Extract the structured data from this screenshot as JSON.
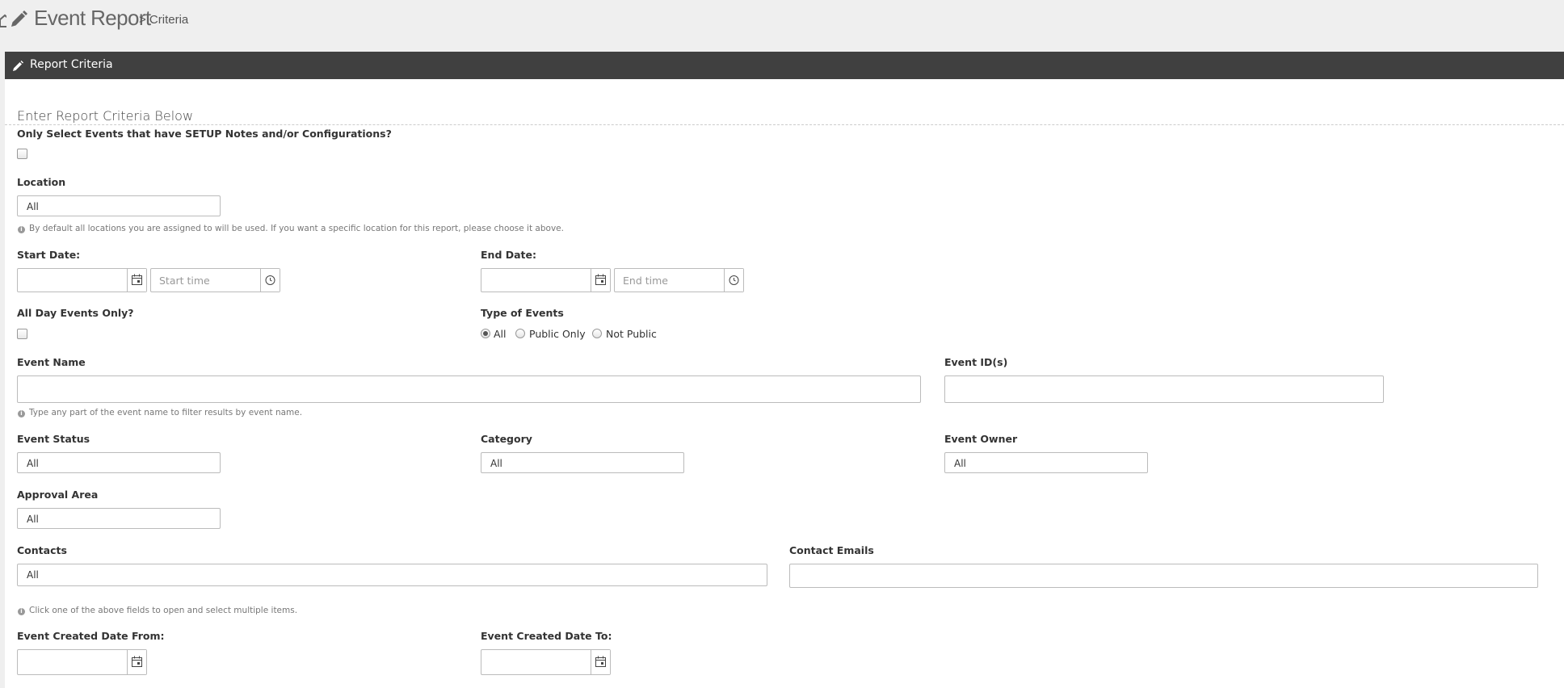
{
  "header": {
    "title": "Event Report",
    "crumb": "> Criteria"
  },
  "panel": {
    "title": "Report Criteria"
  },
  "form": {
    "intro": "Enter Report Criteria Below",
    "setup_only_label": "Only Select Events that have SETUP Notes and/or Configurations?",
    "location_label": "Location",
    "location_value": "All",
    "location_help": "By default all locations you are assigned to will be used. If you want a specific location for this report, please choose it above.",
    "start_date_label": "Start Date:",
    "start_time_placeholder": "Start time",
    "end_date_label": "End Date:",
    "end_time_placeholder": "End time",
    "all_day_label": "All Day Events Only?",
    "type_label": "Type of Events",
    "type_options": [
      "All",
      "Public Only",
      "Not Public"
    ],
    "event_name_label": "Event Name",
    "event_name_help": "Type any part of the event name to filter results by event name.",
    "event_ids_label": "Event ID(s)",
    "event_status_label": "Event Status",
    "event_status_value": "All",
    "category_label": "Category",
    "category_value": "All",
    "event_owner_label": "Event Owner",
    "event_owner_value": "All",
    "approval_area_label": "Approval Area",
    "approval_area_value": "All",
    "contacts_label": "Contacts",
    "contacts_value": "All",
    "contact_emails_label": "Contact Emails",
    "multi_help": "Click one of the above fields to open and select multiple items.",
    "created_from_label": "Event Created Date From:",
    "created_to_label": "Event Created Date To:"
  }
}
